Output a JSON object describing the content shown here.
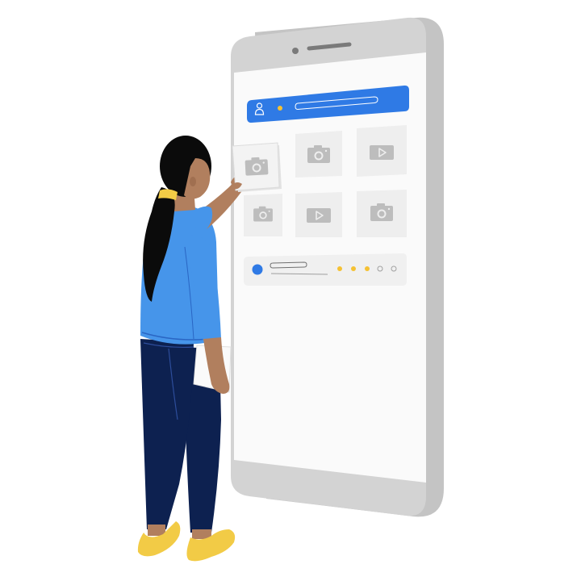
{
  "scene": {
    "subject": "woman-arranging-media-tiles-on-phone",
    "icons": {
      "avatar": "user-icon",
      "photo": "camera-icon",
      "video": "play-icon",
      "rating": "dot-rating-icon"
    },
    "rating": {
      "filled": 3,
      "total": 5
    },
    "colors": {
      "background": "#ffffff",
      "phone_frame": "#d3d3d3",
      "phone_frame_side": "#c4c4c4",
      "screen": "#fafafa",
      "header_blue": "#2f7ae5",
      "tile": "#eeeeee",
      "tile_icon": "#bdbdbd",
      "accent_yellow": "#f5c133",
      "shirt": "#4695ea",
      "pants": "#0d2150",
      "skin": "#b17f5e",
      "hair": "#0b0b0b",
      "shoes": "#f2cb46"
    }
  }
}
